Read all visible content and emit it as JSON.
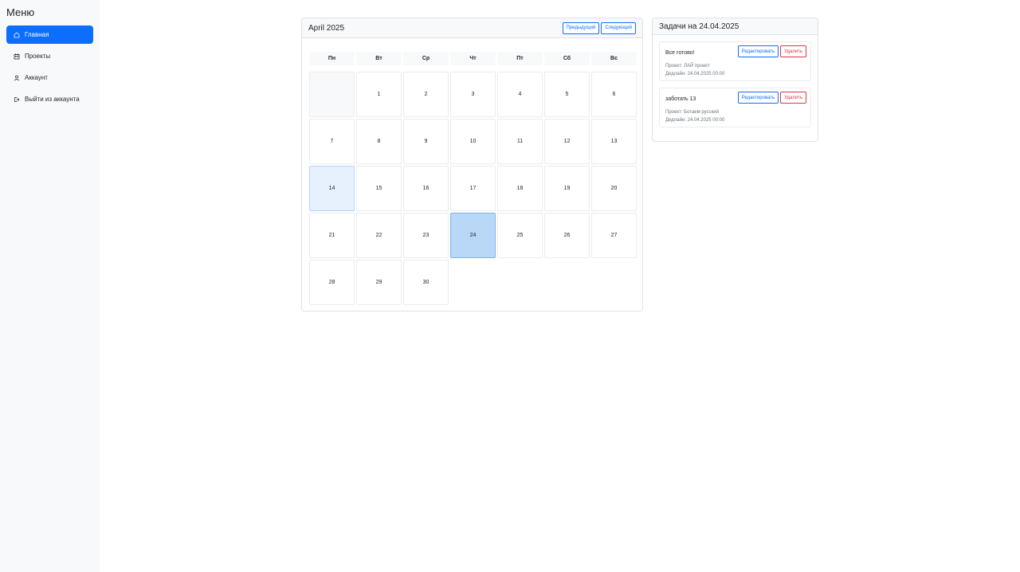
{
  "sidebar": {
    "title": "Меню",
    "items": [
      {
        "label": "Главная",
        "icon": "home-icon",
        "active": true
      },
      {
        "label": "Проекты",
        "icon": "calendar-icon",
        "active": false
      },
      {
        "label": "Аккаунт",
        "icon": "user-icon",
        "active": false
      },
      {
        "label": "Выйти из аккаунта",
        "icon": "logout-icon",
        "active": false
      }
    ]
  },
  "calendar": {
    "month_title": "April 2025",
    "prev_label": "Предыдущий",
    "next_label": "Следующий",
    "weekdays": [
      "Пн",
      "Вт",
      "Ср",
      "Чт",
      "Пт",
      "Сб",
      "Вс"
    ],
    "days": [
      "1",
      "2",
      "3",
      "4",
      "5",
      "6",
      "7",
      "8",
      "9",
      "10",
      "11",
      "12",
      "13",
      "14",
      "15",
      "16",
      "17",
      "18",
      "19",
      "20",
      "21",
      "22",
      "23",
      "24",
      "25",
      "26",
      "27",
      "28",
      "29",
      "30"
    ],
    "today": "14",
    "selected": "24"
  },
  "tasks": {
    "title": "Задачи на 24.04.2025",
    "edit_label": "Редактировать",
    "delete_label": "Удалить",
    "items": [
      {
        "title": "Все готово!",
        "project": "Проект: ЛАЙ проект",
        "deadline": "Дедлайн: 24.04.2025 00:00"
      },
      {
        "title": "заботать 13",
        "project": "Проект: Ботаем русский",
        "deadline": "Дедлайн: 24.04.2025 00:00"
      }
    ]
  },
  "colors": {
    "accent": "#0d6efd",
    "danger": "#dc3545",
    "today_bg": "#e7f1fd",
    "selected_bg": "#b9d7f7"
  }
}
